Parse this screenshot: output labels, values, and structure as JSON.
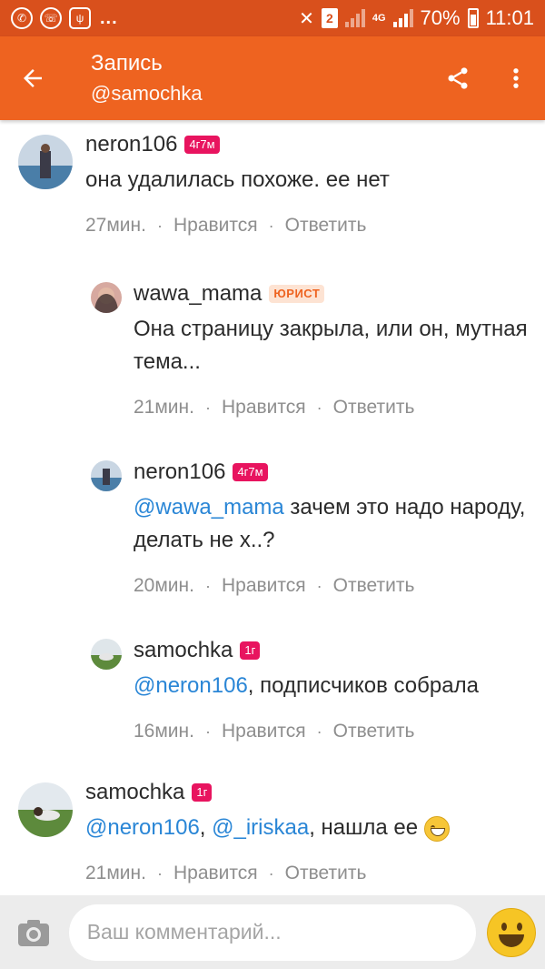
{
  "status_bar": {
    "sim_label": "2",
    "network_type": "4G",
    "battery_percent": "70%",
    "time": "11:01",
    "dots": "..."
  },
  "app_bar": {
    "title": "Запись",
    "subtitle": "@samochka"
  },
  "comments": [
    {
      "author": "neron106",
      "badge": "4г7м",
      "text": "она удалилась похоже. ее нет",
      "time": "27мин.",
      "like_label": "Нравится",
      "reply_label": "Ответить"
    },
    {
      "author": "wawa_mama",
      "badge": "ЮРИСТ",
      "text": "Она страницу закрыла, или он, мутная тема...",
      "time": "21мин.",
      "like_label": "Нравится",
      "reply_label": "Ответить"
    },
    {
      "author": "neron106",
      "badge": "4г7м",
      "mention": "@wawa_mama",
      "text": " зачем это надо народу, делать не х..?",
      "time": "20мин.",
      "like_label": "Нравится",
      "reply_label": "Ответить"
    },
    {
      "author": "samochka",
      "badge": "1г",
      "mention": "@neron106",
      "text": ", подписчиков собрала",
      "time": "16мин.",
      "like_label": "Нравится",
      "reply_label": "Ответить"
    },
    {
      "author": "samochka",
      "badge": "1г",
      "mention": "@neron106",
      "separator": ", ",
      "mention2": "@_iriskaa",
      "text": ", нашла ее ",
      "time": "21мин.",
      "like_label": "Нравится",
      "reply_label": "Ответить"
    }
  ],
  "input": {
    "placeholder": "Ваш комментарий..."
  },
  "colors": {
    "status_bar": "#d9501c",
    "app_bar": "#ee6320",
    "badge_pink": "#e8145f",
    "mention_blue": "#2a86d6",
    "meta_gray": "#8e8e8e"
  },
  "icons": {
    "back": "arrow-left-icon",
    "share": "share-icon",
    "menu": "more-vertical-icon",
    "camera": "camera-icon",
    "emoji": "smiley-icon"
  }
}
